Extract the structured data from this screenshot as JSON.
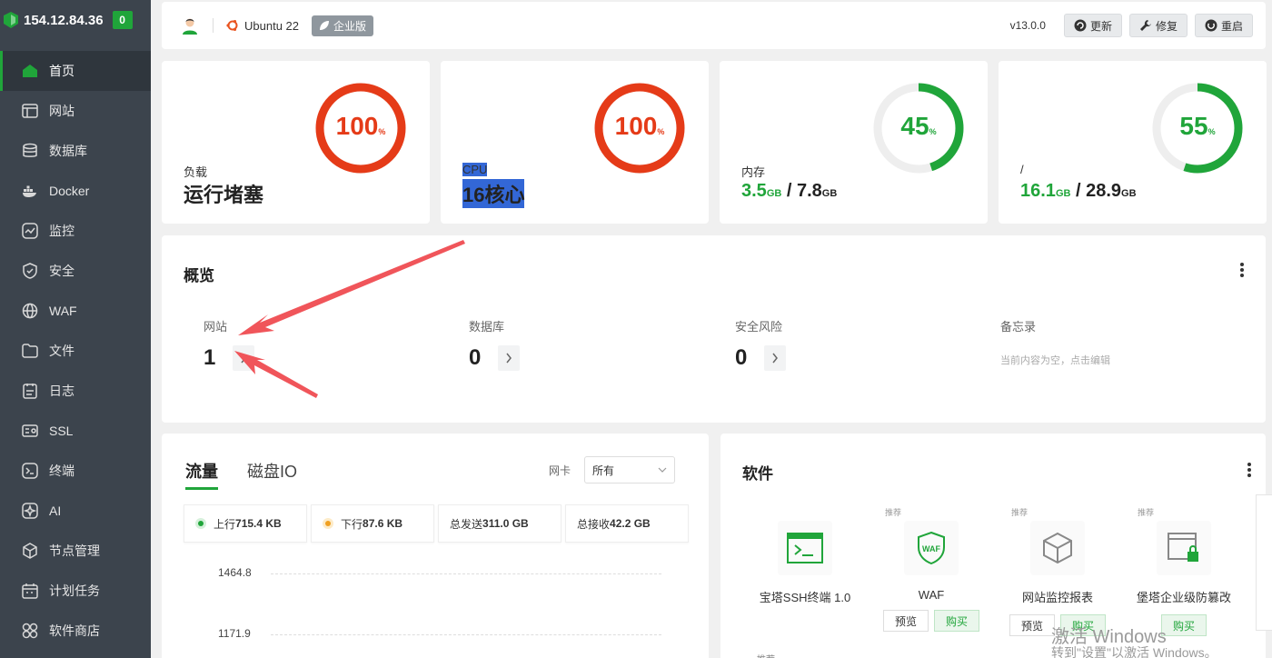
{
  "sidebar": {
    "ip": "154.12.84.36",
    "badge": "0",
    "items": [
      {
        "label": "首页",
        "icon": "home-icon"
      },
      {
        "label": "网站",
        "icon": "website-icon"
      },
      {
        "label": "数据库",
        "icon": "database-icon"
      },
      {
        "label": "Docker",
        "icon": "docker-icon"
      },
      {
        "label": "监控",
        "icon": "monitor-icon"
      },
      {
        "label": "安全",
        "icon": "shield-icon"
      },
      {
        "label": "WAF",
        "icon": "waf-icon"
      },
      {
        "label": "文件",
        "icon": "folder-icon"
      },
      {
        "label": "日志",
        "icon": "log-icon"
      },
      {
        "label": "SSL",
        "icon": "ssl-icon"
      },
      {
        "label": "终端",
        "icon": "terminal-icon"
      },
      {
        "label": "AI",
        "icon": "ai-icon"
      },
      {
        "label": "节点管理",
        "icon": "node-icon"
      },
      {
        "label": "计划任务",
        "icon": "calendar-icon"
      },
      {
        "label": "软件商店",
        "icon": "store-icon"
      }
    ]
  },
  "header": {
    "os": "Ubuntu 22",
    "edition": "企业版",
    "version": "v13.0.0",
    "update": "更新",
    "repair": "修复",
    "restart": "重启"
  },
  "gauges": {
    "load": {
      "percent": "100",
      "label": "负载",
      "status": "运行堵塞",
      "color": "#e53b18"
    },
    "cpu": {
      "percent": "100",
      "label": "CPU",
      "status": "16核心",
      "color": "#e53b18"
    },
    "memory": {
      "percent": "45",
      "label": "内存",
      "used": "3.5",
      "total": "7.8",
      "unit": "GB",
      "color": "#20a53a"
    },
    "disk": {
      "percent": "55",
      "label": "/",
      "used": "16.1",
      "total": "28.9",
      "unit": "GB",
      "color": "#20a53a"
    },
    "pct_sign": "%"
  },
  "overview": {
    "title": "概览",
    "website": {
      "label": "网站",
      "value": "1"
    },
    "database": {
      "label": "数据库",
      "value": "0"
    },
    "risk": {
      "label": "安全风险",
      "value": "0"
    },
    "memo": {
      "label": "备忘录",
      "empty": "当前内容为空，点击编辑"
    }
  },
  "traffic": {
    "tab_traffic": "流量",
    "tab_disk": "磁盘IO",
    "nic_label": "网卡",
    "nic_value": "所有",
    "up_label": "上行",
    "up_value": "715.4 KB",
    "down_label": "下行",
    "down_value": "87.6 KB",
    "sent_label": "总发送",
    "sent_value": "311.0 GB",
    "recv_label": "总接收",
    "recv_value": "42.2 GB",
    "y1": "1464.8",
    "y2": "1171.9"
  },
  "software": {
    "title": "软件",
    "rec": "推荐",
    "preview": "预览",
    "buy": "购买",
    "items": [
      {
        "name": "宝塔SSH终端 1.0"
      },
      {
        "name": "WAF"
      },
      {
        "name": "网站监控报表"
      },
      {
        "name": "堡塔企业级防篡改"
      }
    ],
    "cut": "推荐"
  },
  "watermark": {
    "line1": "激活 Windows",
    "line2": "转到\"设置\"以激活 Windows。"
  }
}
